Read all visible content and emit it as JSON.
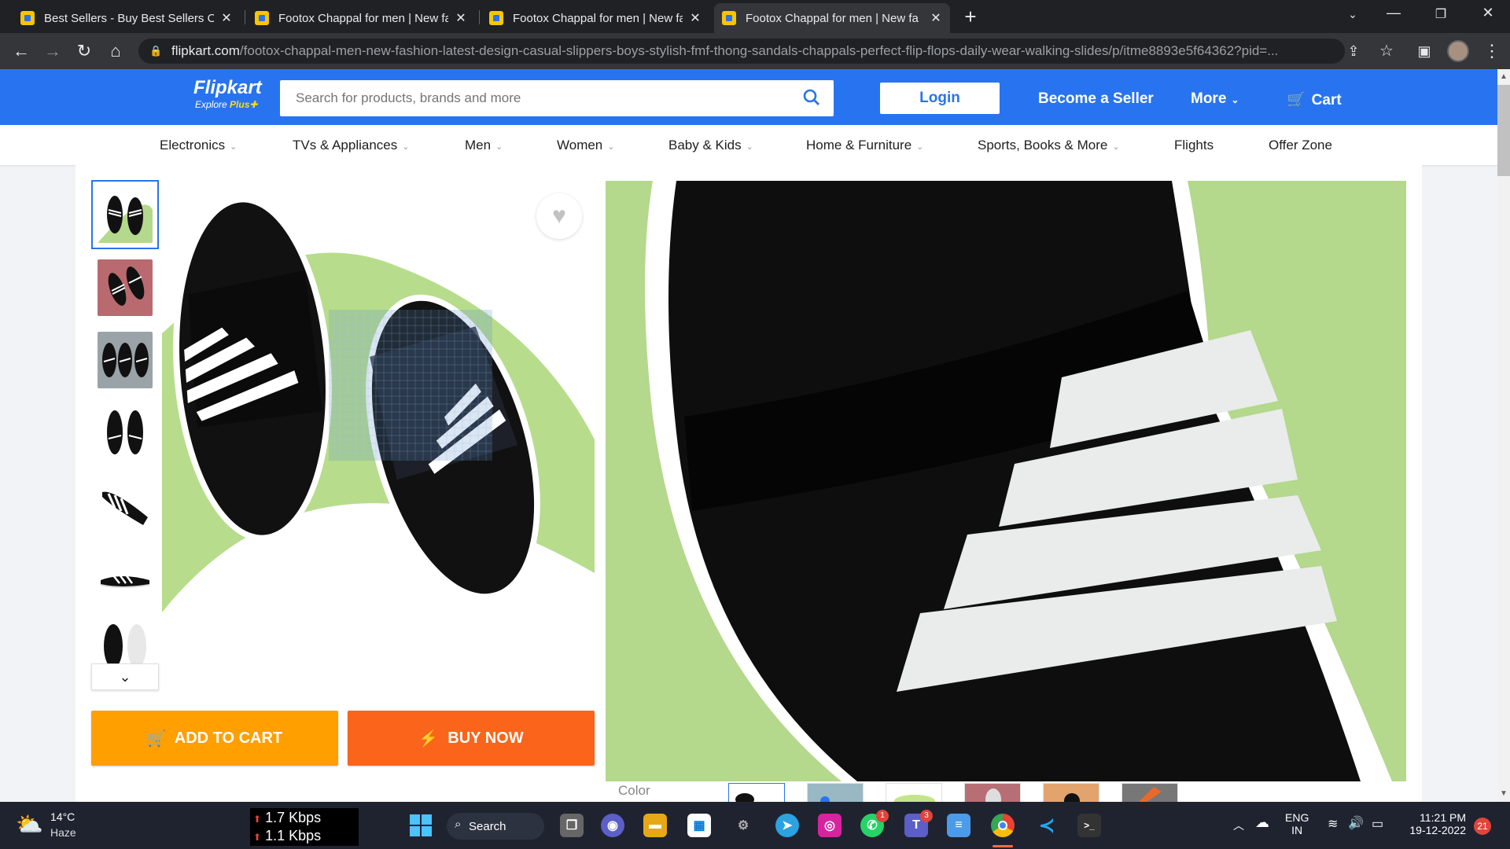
{
  "browser": {
    "tabs": [
      {
        "title": "Best Sellers - Buy Best Sellers Onl",
        "active": false
      },
      {
        "title": "Footox Chappal for men | New fa",
        "active": false
      },
      {
        "title": "Footox Chappal for men | New fa",
        "active": false
      },
      {
        "title": "Footox Chappal for men | New fa",
        "active": true
      }
    ],
    "url_domain": "flipkart.com",
    "url_path": "/footox-chappal-men-new-fashion-latest-design-casual-slippers-boys-stylish-fmf-thong-sandals-chappals-perfect-flip-flops-daily-wear-walking-slides/p/itme8893e5f64362?pid=..."
  },
  "header": {
    "logo": "Flipkart",
    "logo_sub_a": "Explore ",
    "logo_sub_b": "Plus",
    "search_placeholder": "Search for products, brands and more",
    "login": "Login",
    "become_seller": "Become a Seller",
    "more": "More",
    "cart": "Cart",
    "brand_color": "#2874f0"
  },
  "categories": [
    {
      "label": "Electronics",
      "dropdown": true
    },
    {
      "label": "TVs & Appliances",
      "dropdown": true
    },
    {
      "label": "Men",
      "dropdown": true
    },
    {
      "label": "Women",
      "dropdown": true
    },
    {
      "label": "Baby & Kids",
      "dropdown": true
    },
    {
      "label": "Home & Furniture",
      "dropdown": true
    },
    {
      "label": "Sports, Books & More",
      "dropdown": true
    },
    {
      "label": "Flights",
      "dropdown": false
    },
    {
      "label": "Offer Zone",
      "dropdown": false
    }
  ],
  "product": {
    "add_to_cart": "ADD TO CART",
    "buy_now": "BUY NOW",
    "add_to_cart_color": "#ff9f00",
    "buy_now_color": "#fb641b",
    "color_label": "Color"
  },
  "taskbar": {
    "weather_temp": "14°C",
    "weather_desc": "Haze",
    "net_up": "1.7 Kbps",
    "net_down": "1.1 Kbps",
    "search": "Search",
    "lang1": "ENG",
    "lang2": "IN",
    "time": "11:21 PM",
    "date": "19-12-2022",
    "notif_count": "21",
    "whatsapp_badge": "1",
    "teams_badge": "3"
  }
}
